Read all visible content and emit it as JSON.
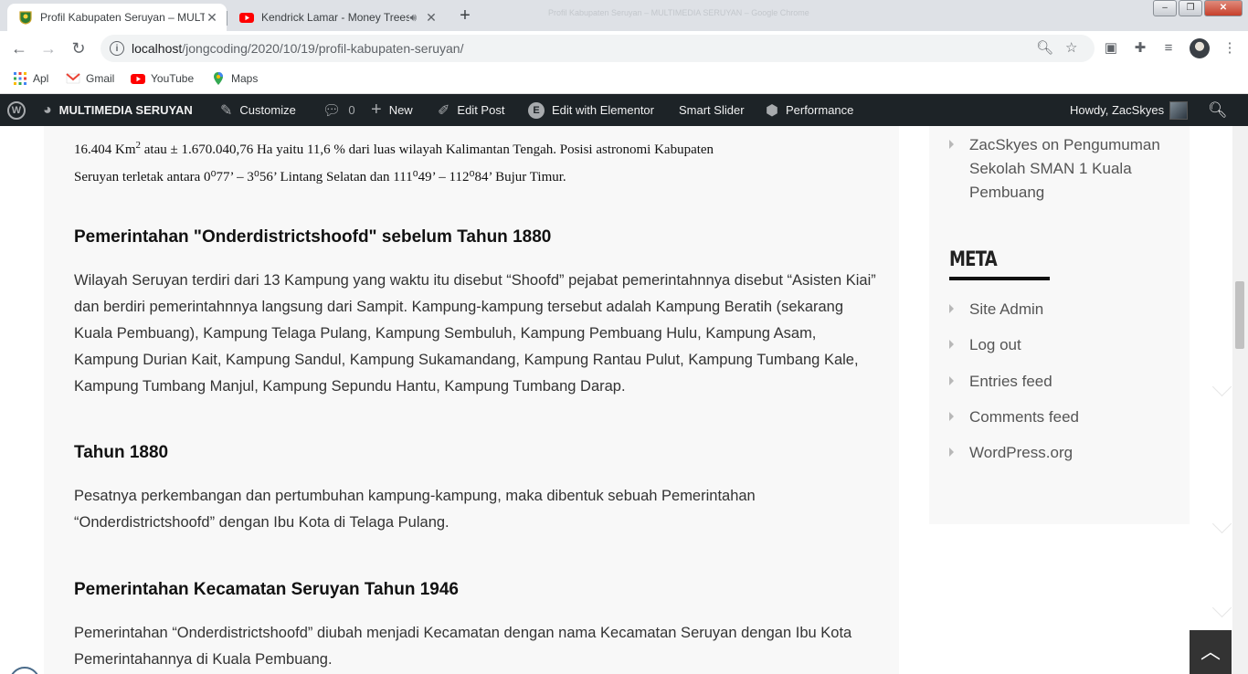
{
  "browser": {
    "tabs": [
      {
        "title": "Profil Kabupaten Seruyan – MULTIMEDIA SERUYAN",
        "active": true,
        "favicon": "seruyan-crest-icon"
      },
      {
        "title": "Kendrick Lamar - Money Trees",
        "active": false,
        "favicon": "youtube-icon",
        "audio": true
      }
    ],
    "window_title_faded": "Profil Kabupaten Seruyan – MULTIMEDIA SERUYAN – Google Chrome",
    "url_host": "localhost",
    "url_path": "/jongcoding/2020/10/19/profil-kabupaten-seruyan/"
  },
  "bookmarks": [
    {
      "label": "Apl",
      "icon": "apps-grid-icon"
    },
    {
      "label": "Gmail",
      "icon": "gmail-icon"
    },
    {
      "label": "YouTube",
      "icon": "youtube-icon"
    },
    {
      "label": "Maps",
      "icon": "maps-pin-icon"
    }
  ],
  "adminbar": {
    "site": "MULTIMEDIA SERUYAN",
    "customize": "Customize",
    "comments": "0",
    "new": "New",
    "edit_post": "Edit Post",
    "elementor": "Edit with Elementor",
    "smart_slider": "Smart Slider",
    "performance": "Performance",
    "howdy": "Howdy, ZacSkyes"
  },
  "article": {
    "intro_line1_a": "16.404 Km",
    "intro_line1_sup": "2",
    "intro_line1_b": " atau ± 1.670.040,76 Ha yaitu 11,6 % dari luas wilayah Kalimantan Tengah. Posisi astronomi Kabupaten",
    "intro_line2": "Seruyan terletak antara   0⁰77’ – 3⁰56’ Lintang Selatan dan 111⁰49’ – 112⁰84’ Bujur Timur.",
    "sections": [
      {
        "heading": "Pemerintahan \"Onderdistrictshoofd\" sebelum Tahun 1880",
        "body": "Wilayah Seruyan terdiri dari 13 Kampung yang waktu itu disebut “Shoofd” pejabat pemerintahnnya disebut “Asisten Kiai” dan berdiri pemerintahnnya langsung dari Sampit. Kampung-kampung tersebut adalah Kampung Beratih (sekarang Kuala Pembuang), Kampung Telaga Pulang, Kampung Sembuluh, Kampung Pembuang Hulu, Kampung Asam, Kampung Durian Kait, Kampung Sandul, Kampung Sukamandang, Kampung Rantau Pulut, Kampung Tumbang Kale, Kampung Tumbang Manjul, Kampung Sepundu Hantu, Kampung Tumbang Darap."
      },
      {
        "heading": "Tahun 1880",
        "body": "Pesatnya perkembangan dan pertumbuhan kampung-kampung, maka dibentuk sebuah Pemerintahan “Onderdistrictshoofd” dengan Ibu Kota di Telaga Pulang."
      },
      {
        "heading": "Pemerintahan Kecamatan Seruyan Tahun 1946",
        "body": "Pemerintahan “Onderdistrictshoofd” diubah menjadi Kecamatan dengan nama Kecamatan Seruyan dengan Ibu Kota Pemerintahannya di Kuala Pembuang."
      }
    ]
  },
  "sidebar": {
    "recent_comment": "ZacSkyes on Pengumuman Sekolah SMAN 1 Kuala Pembuang",
    "meta_title": "META",
    "meta_links": [
      "Site Admin",
      "Log out",
      "Entries feed",
      "Comments feed",
      "WordPress.org"
    ]
  },
  "colors": {
    "adminbar_bg": "#1d2327",
    "article_bg": "#f8f8f8",
    "tabstrip_bg": "#dee1e6"
  }
}
